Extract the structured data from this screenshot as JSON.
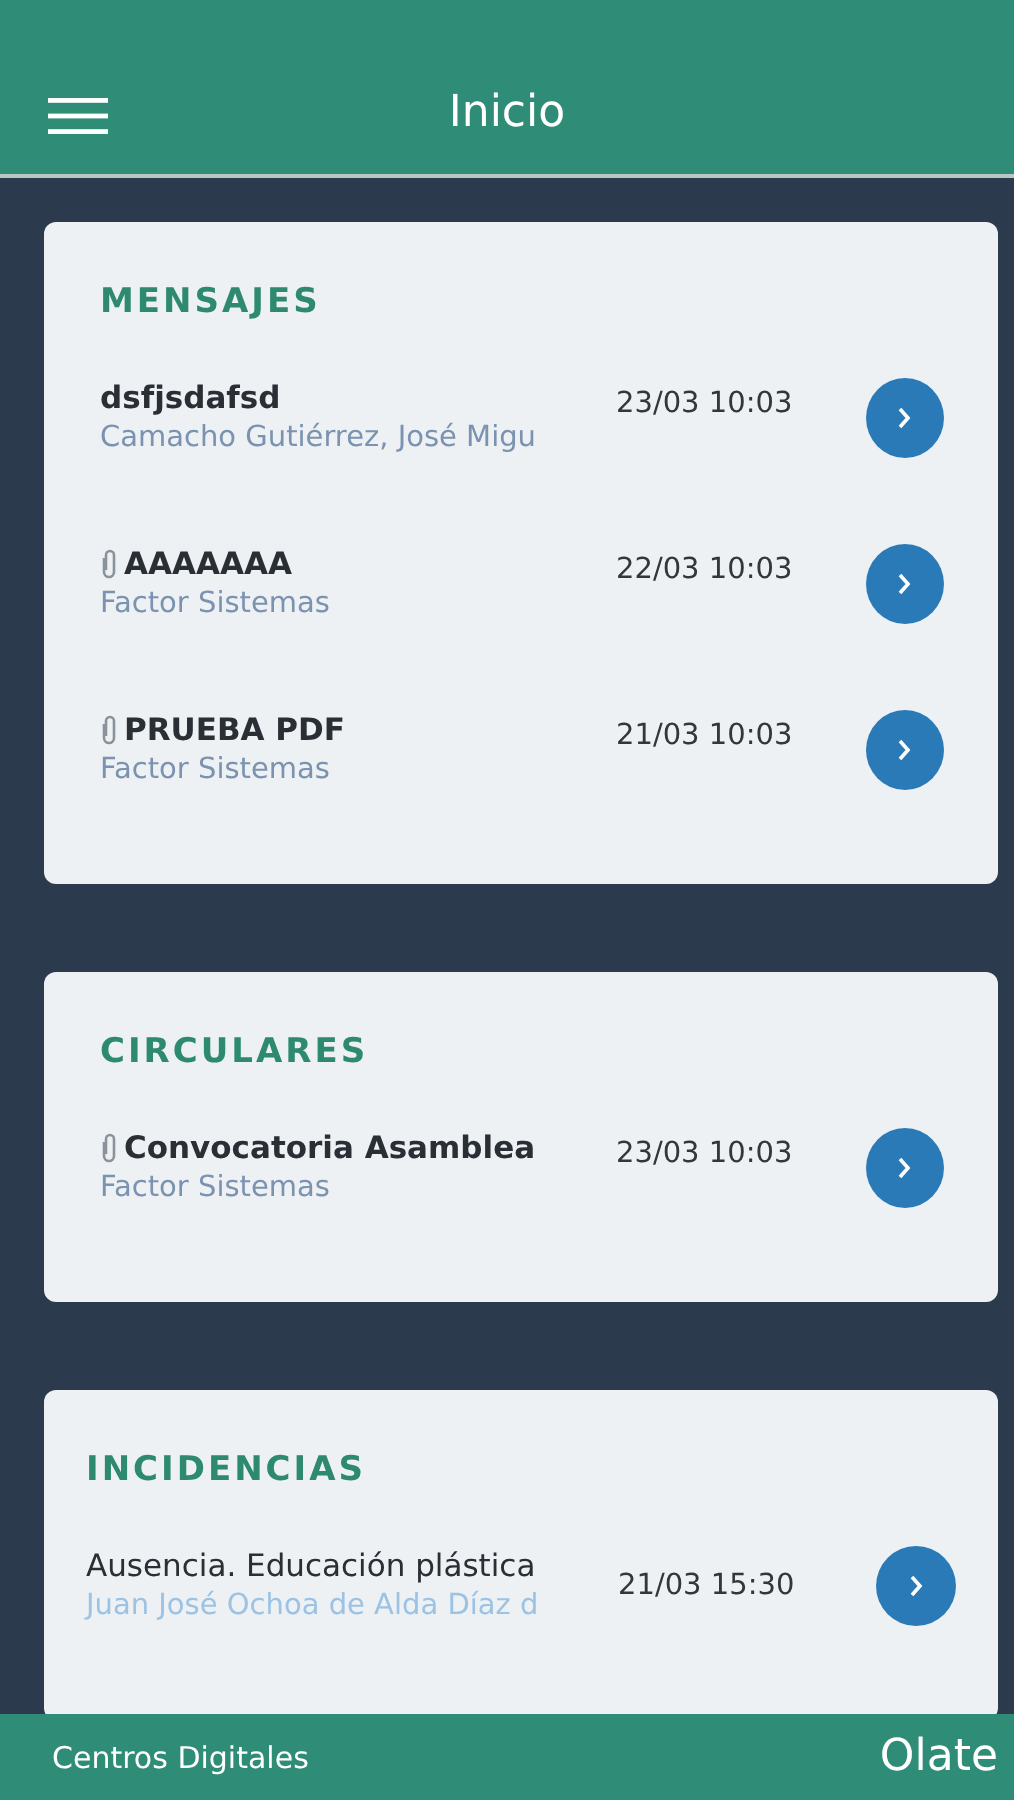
{
  "header": {
    "title": "Inicio"
  },
  "sections": [
    {
      "kind": "messages",
      "title": "MENSAJES",
      "items": [
        {
          "title": "dsfjsdafsd",
          "subtitle": "Camacho Gutiérrez, José Migu",
          "time": "23/03 10:03",
          "attachment": false
        },
        {
          "title": "AAAAAAA",
          "subtitle": "Factor Sistemas",
          "time": "22/03 10:03",
          "attachment": true
        },
        {
          "title": "PRUEBA PDF",
          "subtitle": "Factor Sistemas",
          "time": "21/03 10:03",
          "attachment": true
        }
      ]
    },
    {
      "kind": "messages",
      "title": "CIRCULARES",
      "items": [
        {
          "title": "Convocatoria Asamblea",
          "subtitle": "Factor Sistemas",
          "time": "23/03 10:03",
          "attachment": true
        }
      ]
    },
    {
      "kind": "incidents",
      "title": "INCIDENCIAS",
      "items": [
        {
          "title": "Ausencia. Educación plástica",
          "subtitle": "Juan José Ochoa de Alda Díaz d",
          "time": "21/03 15:30",
          "attachment": false
        }
      ]
    }
  ],
  "footer": {
    "label": "Centros Digitales",
    "school": "Olate"
  }
}
